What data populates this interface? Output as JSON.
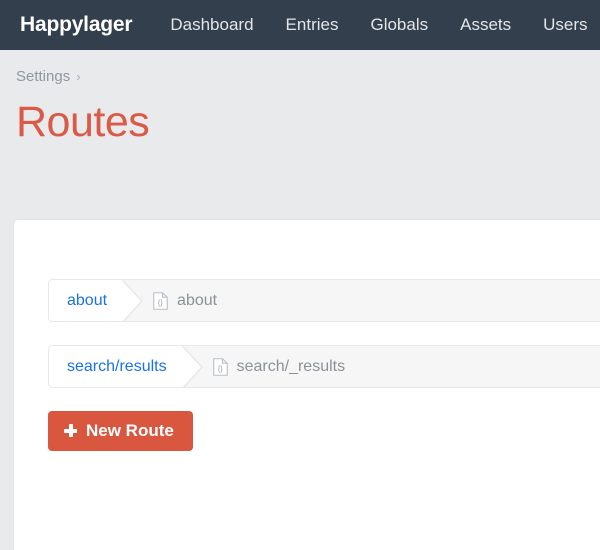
{
  "navbar": {
    "brand": "Happylager",
    "items": [
      {
        "label": "Dashboard"
      },
      {
        "label": "Entries"
      },
      {
        "label": "Globals"
      },
      {
        "label": "Assets"
      },
      {
        "label": "Users"
      }
    ],
    "background_color": "#333f4d"
  },
  "breadcrumb": {
    "parent": "Settings",
    "separator": "›"
  },
  "page": {
    "title": "Routes",
    "title_color": "#da5a47"
  },
  "routes": [
    {
      "uri": "about",
      "template": "about",
      "template_icon": "twig-template-icon"
    },
    {
      "uri": "search/results",
      "template": "search/_results",
      "template_icon": "twig-template-icon"
    }
  ],
  "actions": {
    "new_route_label": "New Route",
    "new_route_icon": "plus-icon",
    "new_route_color": "#d9563f"
  }
}
